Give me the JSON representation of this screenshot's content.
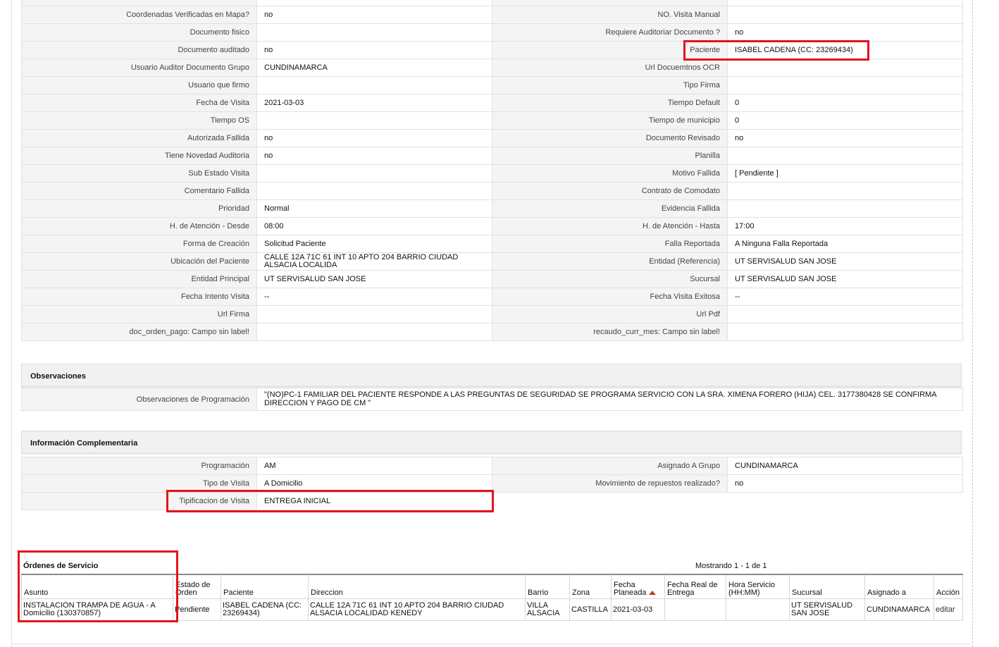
{
  "details": {
    "rows": [
      {
        "l_label": "Coordenadas Verificadas en Mapa?",
        "l_value": "no",
        "r_label": "NO. Visita Manual",
        "r_value": ""
      },
      {
        "l_label": "Documento fisico",
        "l_value": "",
        "r_label": "Requiere Auditoriar Documento ?",
        "r_value": "no"
      },
      {
        "l_label": "Documento auditado",
        "l_value": "no",
        "r_label": "Paciente",
        "r_value": "ISABEL CADENA (CC: 23269434)"
      },
      {
        "l_label": "Usuario Auditor Documento Grupo",
        "l_value": "CUNDINAMARCA",
        "r_label": "Url Docuemtnos OCR",
        "r_value": ""
      },
      {
        "l_label": "Usuario que firmo",
        "l_value": "",
        "r_label": "Tipo Firma",
        "r_value": ""
      },
      {
        "l_label": "Fecha de Visita",
        "l_value": "2021-03-03",
        "r_label": "Tiempo Default",
        "r_value": "0"
      },
      {
        "l_label": "Tiempo OS",
        "l_value": "",
        "r_label": "Tiempo de municipio",
        "r_value": "0"
      },
      {
        "l_label": "Autorizada Fallida",
        "l_value": "no",
        "r_label": "Documento Revisado",
        "r_value": "no"
      },
      {
        "l_label": "Tiene Novedad Auditoria",
        "l_value": "no",
        "r_label": "Planilla",
        "r_value": ""
      },
      {
        "l_label": "Sub Estado Visita",
        "l_value": "",
        "r_label": "Motivo Fallida",
        "r_value": "[ Pendiente ]"
      },
      {
        "l_label": "Comentario Fallida",
        "l_value": "",
        "r_label": "Contrato de Comodato",
        "r_value": ""
      },
      {
        "l_label": "Prioridad",
        "l_value": "Normal",
        "r_label": "Evidencia Fallida",
        "r_value": ""
      },
      {
        "l_label": "H. de Atención - Desde",
        "l_value": "08:00",
        "r_label": "H. de Atención - Hasta",
        "r_value": "17:00"
      },
      {
        "l_label": "Forma de Creación",
        "l_value": "Solicitud Paciente",
        "r_label": "Falla Reportada",
        "r_value": "A Ninguna Falla Reportada"
      },
      {
        "l_label": "Ubicación del Paciente",
        "l_value": "CALLE 12A 71C 61 INT 10 APTO 204 BARRIO CIUDAD ALSACIA LOCALIDA",
        "r_label": "Entidad (Referencia)",
        "r_value": "UT SERVISALUD SAN JOSE"
      },
      {
        "l_label": "Entidad Principal",
        "l_value": "UT SERVISALUD SAN JOSE",
        "r_label": "Sucursal",
        "r_value": "UT SERVISALUD SAN JOSE"
      },
      {
        "l_label": "Fecha Intento Visita",
        "l_value": "--",
        "r_label": "Fecha Visita Exitosa",
        "r_value": "--"
      },
      {
        "l_label": "Url Firma",
        "l_value": "",
        "r_label": "Url Pdf",
        "r_value": ""
      },
      {
        "l_label": "doc_orden_pago: Campo sin label!",
        "l_value": "",
        "r_label": "recaudo_curr_mes: Campo sin label!",
        "r_value": ""
      }
    ]
  },
  "observaciones": {
    "title": "Observaciones",
    "label": "Observaciones de Programación",
    "value": "\"(NO)PC-1 FAMILIAR DEL PACIENTE RESPONDE A LAS PREGUNTAS DE SEGURIDAD SE PROGRAMA SERVICIO CON LA SRA. XIMENA FORERO (HIJA) CEL. 3177380428 SE CONFIRMA DIRECCION Y PAGO DE CM \""
  },
  "info": {
    "title": "Información Complementaria",
    "programacion_label": "Programación",
    "programacion_value": "AM",
    "asignado_label": "Asignado A Grupo",
    "asignado_value": "CUNDINAMARCA",
    "tipo_label": "Tipo de Visita",
    "tipo_value": "A Domicilio",
    "movimiento_label": "Movimiento de repuestos realizado?",
    "movimiento_value": "no",
    "tipificacion_label": "Tipificacion de Visita",
    "tipificacion_value": "ENTREGA INICIAL"
  },
  "orders": {
    "title": "Órdenes de Servicio",
    "count_text": "Mostrando 1 - 1 de 1",
    "columns": [
      "Asunto",
      "Estado de Orden",
      "Paciente",
      "Direccion",
      "Barrio",
      "Zona",
      "Fecha Planeada",
      "Fecha Real de Entrega",
      "Hora Servicio (HH:MM)",
      "Sucursal",
      "Asignado a",
      "Acción"
    ],
    "row": {
      "asunto": "INSTALACION TRAMPA DE AGUA - A Domicilio (130370857)",
      "estado": "Pendiente",
      "paciente": "ISABEL CADENA (CC: 23269434)",
      "direccion": "CALLE 12A 71C 61 INT 10 APTO 204 BARRIO CIUDAD ALSACIA LOCALIDAD KENEDY",
      "barrio": "VILLA ALSACIA",
      "zona": "CASTILLA",
      "fecha_planeada": "2021-03-03",
      "fecha_real": "",
      "hora": "",
      "sucursal": "UT SERVISALUD SAN JOSE",
      "asignado": "CUNDINAMARCA",
      "accion": "editar"
    }
  },
  "colors": {
    "highlight": "#e3141c",
    "sort_icon": "#c0392b"
  }
}
